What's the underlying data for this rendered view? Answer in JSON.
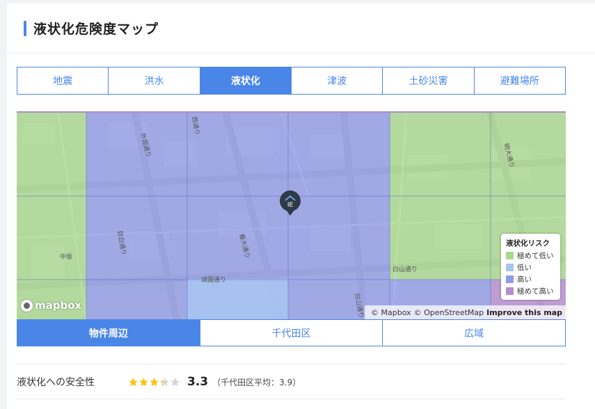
{
  "header": {
    "title": "液状化危険度マップ"
  },
  "tabs": [
    {
      "label": "地震",
      "active": false
    },
    {
      "label": "洪水",
      "active": false
    },
    {
      "label": "液状化",
      "active": true
    },
    {
      "label": "津波",
      "active": false
    },
    {
      "label": "土砂災害",
      "active": false
    },
    {
      "label": "避難場所",
      "active": false
    }
  ],
  "map": {
    "street_labels": [
      "外堀通り",
      "明大通り",
      "白山通り",
      "目白通り",
      "中坂",
      "西通り",
      "春大通り",
      "靖国通り",
      "白山通り"
    ],
    "legend": {
      "title": "液状化リスク",
      "items": [
        {
          "label": "極めて低い",
          "color": "#a9d98d"
        },
        {
          "label": "低い",
          "color": "#a9c4ef"
        },
        {
          "label": "高い",
          "color": "#8f9be6"
        },
        {
          "label": "極めて高い",
          "color": "#b78dd0"
        }
      ]
    },
    "logo_text": "mapbox",
    "attribution": {
      "mapbox": "© Mapbox",
      "osm": "© OpenStreetMap",
      "improve": "Improve this map"
    },
    "pin_icon": "home-pin-icon",
    "pin_text": "IE"
  },
  "scope_tabs": [
    {
      "label": "物件周辺",
      "active": true
    },
    {
      "label": "千代田区",
      "active": false
    },
    {
      "label": "広域",
      "active": false
    }
  ],
  "safety": {
    "label": "液状化への安全性",
    "rating": 3.3,
    "score_text": "3.3",
    "average_text": "（千代田区平均：3.9）",
    "star_color": "#f5c518"
  }
}
